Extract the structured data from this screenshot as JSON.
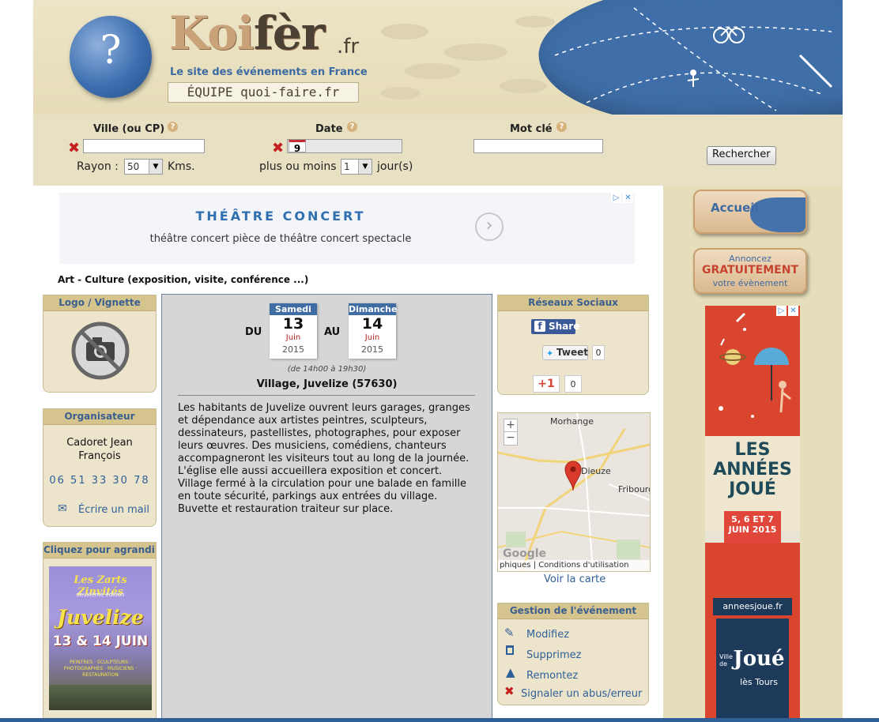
{
  "header": {
    "logo_main": "Koi",
    "logo_bold": "fèr",
    "logo_suffix": ".fr",
    "tagline": "Le site des événements en France",
    "team": "ÉQUIPE quoi-faire.fr",
    "globe_symbol": "?"
  },
  "search": {
    "city_label": "Ville (ou CP)",
    "date_label": "Date",
    "keyword_label": "Mot clé",
    "help_symbol": "?",
    "clear_symbol": "✖",
    "city_value": "",
    "date_value": "9",
    "keyword_value": "",
    "radius_label": "Rayon :",
    "radius_value": "50",
    "radius_unit": "Kms.",
    "plusminus_label": "plus ou moins",
    "plusminus_value": "1",
    "plusminus_unit": "jour(s)",
    "submit_label": "Rechercher"
  },
  "ad_top": {
    "title": "THÉÂTRE CONCERT",
    "subtitle": "théâtre concert pièce de théâtre concert spectacle"
  },
  "breadcrumb": "Art - Culture (exposition, visite, conférence ...)",
  "logo_box": {
    "title": "Logo / Vignette"
  },
  "organizer_box": {
    "title": "Organisateur",
    "name": "Cadoret Jean François",
    "phone": "06 51 33 30 78",
    "mail_label": "Écrire un mail"
  },
  "poster_box": {
    "title": "Cliquez pour agrandir",
    "line1": "Les Zarts Zinvités",
    "line2": "deuxième édition",
    "town": "Juvelize",
    "dates": "13 & 14 JUIN",
    "info": "PEINTRES · SCULPTEURS · PHOTOGRAPHES · MUSICIENS · RESTAURATION"
  },
  "event": {
    "du": "DU",
    "au": "AU",
    "start": {
      "day": "Samedi",
      "num": "13",
      "month": "Juin",
      "year": "2015"
    },
    "end": {
      "day": "Dimanche",
      "num": "14",
      "month": "Juin",
      "year": "2015"
    },
    "hours": "(de 14h00 à 19h30)",
    "place": "Village, Juvelize (57630)",
    "description": "Les habitants de Juvelize ouvrent leurs garages, granges et dépendance aux artistes peintres, sculpteurs, dessinateurs, pastellistes, photographes, pour exposer leurs œuvres. Des musiciens, comédiens, chanteurs accompagneront les visiteurs tout au long de la journée. L'église elle aussi accueillera exposition et concert. Village fermé à la circulation pour une balade en famille en toute sécurité, parkings aux entrées du village. Buvette et restauration traiteur sur place."
  },
  "social": {
    "title": "Réseaux Sociaux",
    "fb_label": "Share",
    "tweet_label": "Tweet",
    "tweet_count": "0",
    "gplus_label": "+1",
    "gplus_count": "0"
  },
  "map": {
    "town1": "Morhange",
    "town2": "Dieuze",
    "town3": "Fribourg",
    "zoom_in": "+",
    "zoom_out": "−",
    "footer": "phiques | Conditions d'utilisation",
    "google": "Google",
    "link_label": "Voir la carte"
  },
  "management": {
    "title": "Gestion de l'événement",
    "edit": "Modifiez",
    "delete": "Supprimez",
    "bump": "Remontez",
    "report": "Signaler un abus/erreur"
  },
  "right_menu": {
    "home": "Accueil",
    "announce_top": "Annoncez",
    "announce_mid": "GRATUITEMENT",
    "announce_bottom": "votre évènement"
  },
  "ad_side": {
    "title1": "LES",
    "title2": "ANNÉES",
    "title3": "JOUÉ",
    "dates": "5, 6 ET 7 JUIN 2015",
    "url": "anneesjoue.fr",
    "city_small": "Ville de",
    "city": "Joué",
    "city_sub": "lès Tours"
  },
  "colors": {
    "header_bg": "#e6dcb8",
    "accent_blue": "#3e6ca3",
    "box_header": "#d6c48f",
    "ad_red": "#d9452e"
  }
}
